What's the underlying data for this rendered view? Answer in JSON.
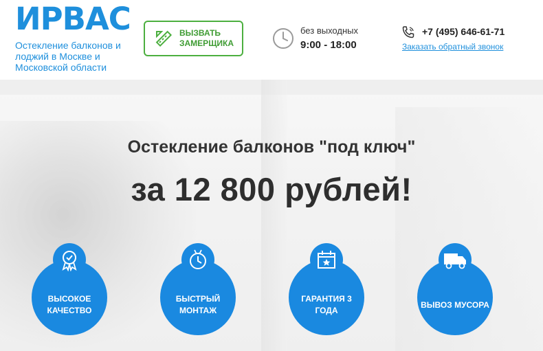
{
  "header": {
    "logo_text": "ИРВАС",
    "tagline": "Остекление балконов и лоджий в Москве и Московской области",
    "call_button_label": "ВЫЗВАТЬ ЗАМЕРЩИКА",
    "hours_label": "без выходных",
    "hours_value": "9:00 - 18:00",
    "phone": "+7 (495) 646-61-71",
    "callback_link": "Заказать обратный звонок"
  },
  "hero": {
    "headline": "Остекление балконов \"под ключ\"",
    "price": "за 12 800 рублей!",
    "features": [
      {
        "label": "ВЫСОКОЕ КАЧЕСТВО",
        "icon": "quality-badge-icon"
      },
      {
        "label": "БЫСТРЫЙ МОНТАЖ",
        "icon": "stopwatch-icon"
      },
      {
        "label": "ГАРАНТИЯ 3 ГОДА",
        "icon": "calendar-icon"
      },
      {
        "label": "ВЫВОЗ МУСОРА",
        "icon": "truck-icon"
      }
    ]
  },
  "colors": {
    "brand_blue": "#1e8fdc",
    "feature_blue": "#1a89e0",
    "button_green": "#4caf3f",
    "text_dark": "#2e2e2e"
  }
}
